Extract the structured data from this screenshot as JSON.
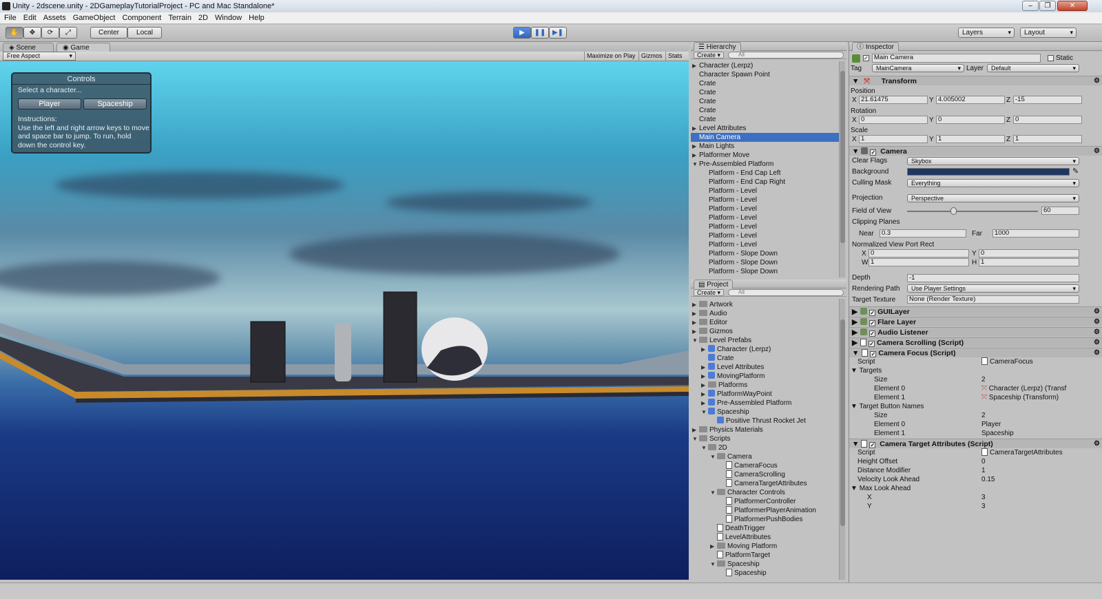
{
  "window": {
    "title": "Unity - 2dscene.unity - 2DGameplayTutorialProject - PC and Mac Standalone*"
  },
  "menu": [
    "File",
    "Edit",
    "Assets",
    "GameObject",
    "Component",
    "Terrain",
    "2D",
    "Window",
    "Help"
  ],
  "toolbar": {
    "pivot": "Center",
    "space": "Local",
    "layers": "Layers",
    "layout": "Layout"
  },
  "scene_tabs": {
    "scene": "Scene",
    "game": "Game",
    "aspect": "Free Aspect",
    "maximize": "Maximize on Play",
    "gizmos": "Gizmos",
    "stats": "Stats"
  },
  "game_ui": {
    "title": "Controls",
    "select": "Select a character...",
    "player": "Player",
    "spaceship": "Spaceship",
    "instructions_title": "Instructions:",
    "instructions": "Use the left and right arrow keys to move and space bar to jump.  To run, hold down the control key."
  },
  "hierarchy": {
    "title": "Hierarchy",
    "create": "Create",
    "search": "All",
    "items": [
      {
        "label": "Character (Lerpz)",
        "arrow": "▶",
        "indent": 0
      },
      {
        "label": "Character Spawn Point",
        "arrow": "",
        "indent": 0
      },
      {
        "label": "Crate",
        "arrow": "",
        "indent": 0
      },
      {
        "label": "Crate",
        "arrow": "",
        "indent": 0
      },
      {
        "label": "Crate",
        "arrow": "",
        "indent": 0
      },
      {
        "label": "Crate",
        "arrow": "",
        "indent": 0
      },
      {
        "label": "Crate",
        "arrow": "",
        "indent": 0
      },
      {
        "label": "Level Attributes",
        "arrow": "▶",
        "indent": 0
      },
      {
        "label": "Main Camera",
        "arrow": "",
        "indent": 0,
        "selected": true
      },
      {
        "label": "Main Lights",
        "arrow": "▶",
        "indent": 0
      },
      {
        "label": "Platformer Move",
        "arrow": "▶",
        "indent": 0
      },
      {
        "label": "Pre-Assembled Platform",
        "arrow": "▼",
        "indent": 0
      },
      {
        "label": "Platform - End Cap Left",
        "arrow": "",
        "indent": 1
      },
      {
        "label": "Platform - End Cap Right",
        "arrow": "",
        "indent": 1
      },
      {
        "label": "Platform - Level",
        "arrow": "",
        "indent": 1
      },
      {
        "label": "Platform - Level",
        "arrow": "",
        "indent": 1
      },
      {
        "label": "Platform - Level",
        "arrow": "",
        "indent": 1
      },
      {
        "label": "Platform - Level",
        "arrow": "",
        "indent": 1
      },
      {
        "label": "Platform - Level",
        "arrow": "",
        "indent": 1
      },
      {
        "label": "Platform - Level",
        "arrow": "",
        "indent": 1
      },
      {
        "label": "Platform - Level",
        "arrow": "",
        "indent": 1
      },
      {
        "label": "Platform - Slope Down",
        "arrow": "",
        "indent": 1
      },
      {
        "label": "Platform - Slope Down",
        "arrow": "",
        "indent": 1
      },
      {
        "label": "Platform - Slope Down",
        "arrow": "",
        "indent": 1
      }
    ]
  },
  "project": {
    "title": "Project",
    "create": "Create",
    "search": "All",
    "items": [
      {
        "label": "Artwork",
        "arrow": "▶",
        "indent": 0,
        "kind": "folder"
      },
      {
        "label": "Audio",
        "arrow": "▶",
        "indent": 0,
        "kind": "folder"
      },
      {
        "label": "Editor",
        "arrow": "▶",
        "indent": 0,
        "kind": "folder"
      },
      {
        "label": "Gizmos",
        "arrow": "▶",
        "indent": 0,
        "kind": "folder"
      },
      {
        "label": "Level Prefabs",
        "arrow": "▼",
        "indent": 0,
        "kind": "folder"
      },
      {
        "label": "Character (Lerpz)",
        "arrow": "▶",
        "indent": 1,
        "kind": "prefab"
      },
      {
        "label": "Crate",
        "arrow": "",
        "indent": 1,
        "kind": "prefab"
      },
      {
        "label": "Level Attributes",
        "arrow": "▶",
        "indent": 1,
        "kind": "prefab"
      },
      {
        "label": "MovingPlatform",
        "arrow": "▶",
        "indent": 1,
        "kind": "prefab"
      },
      {
        "label": "Platforms",
        "arrow": "▶",
        "indent": 1,
        "kind": "folder"
      },
      {
        "label": "PlatformWayPoint",
        "arrow": "▶",
        "indent": 1,
        "kind": "prefab"
      },
      {
        "label": "Pre-Assembled Platform",
        "arrow": "▶",
        "indent": 1,
        "kind": "prefab"
      },
      {
        "label": "Spaceship",
        "arrow": "▼",
        "indent": 1,
        "kind": "prefab"
      },
      {
        "label": "Positive Thrust Rocket Jet",
        "arrow": "",
        "indent": 2,
        "kind": "prefab"
      },
      {
        "label": "Physics Materials",
        "arrow": "▶",
        "indent": 0,
        "kind": "folder"
      },
      {
        "label": "Scripts",
        "arrow": "▼",
        "indent": 0,
        "kind": "folder"
      },
      {
        "label": "2D",
        "arrow": "▼",
        "indent": 1,
        "kind": "folder"
      },
      {
        "label": "Camera",
        "arrow": "▼",
        "indent": 2,
        "kind": "folder"
      },
      {
        "label": "CameraFocus",
        "arrow": "",
        "indent": 3,
        "kind": "script"
      },
      {
        "label": "CameraScrolling",
        "arrow": "",
        "indent": 3,
        "kind": "script"
      },
      {
        "label": "CameraTargetAttributes",
        "arrow": "",
        "indent": 3,
        "kind": "script"
      },
      {
        "label": "Character Controls",
        "arrow": "▼",
        "indent": 2,
        "kind": "folder"
      },
      {
        "label": "PlatformerController",
        "arrow": "",
        "indent": 3,
        "kind": "script"
      },
      {
        "label": "PlatformerPlayerAnimation",
        "arrow": "",
        "indent": 3,
        "kind": "script"
      },
      {
        "label": "PlatformerPushBodies",
        "arrow": "",
        "indent": 3,
        "kind": "script"
      },
      {
        "label": "DeathTrigger",
        "arrow": "",
        "indent": 2,
        "kind": "script"
      },
      {
        "label": "LevelAttributes",
        "arrow": "",
        "indent": 2,
        "kind": "script"
      },
      {
        "label": "Moving Platform",
        "arrow": "▶",
        "indent": 2,
        "kind": "folder"
      },
      {
        "label": "PlatformTarget",
        "arrow": "",
        "indent": 2,
        "kind": "script"
      },
      {
        "label": "Spaceship",
        "arrow": "▼",
        "indent": 2,
        "kind": "folder"
      },
      {
        "label": "Spaceship",
        "arrow": "",
        "indent": 3,
        "kind": "script"
      }
    ]
  },
  "inspector": {
    "title": "Inspector",
    "object_name": "Main Camera",
    "static": "Static",
    "tag_label": "Tag",
    "tag": "MainCamera",
    "layer_label": "Layer",
    "layer": "Default",
    "transform": {
      "title": "Transform",
      "position": "Position",
      "pos": [
        "21.61475",
        "4.005002",
        "-15"
      ],
      "rotation": "Rotation",
      "rot": [
        "0",
        "0",
        "0"
      ],
      "scale": "Scale",
      "scl": [
        "1",
        "1",
        "1"
      ]
    },
    "camera": {
      "title": "Camera",
      "clear_flags_label": "Clear Flags",
      "clear_flags": "Skybox",
      "background_label": "Background",
      "background_color": "#1f3763",
      "culling_label": "Culling Mask",
      "culling": "Everything",
      "projection_label": "Projection",
      "projection": "Perspective",
      "fov_label": "Field of View",
      "fov": "60",
      "fov_fraction": 0.35,
      "clipping_label": "Clipping Planes",
      "near_label": "Near",
      "near": "0.3",
      "far_label": "Far",
      "far": "1000",
      "viewport_label": "Normalized View Port Rect",
      "vx": "0",
      "vy": "0",
      "vw": "1",
      "vh": "1",
      "depth_label": "Depth",
      "depth": "-1",
      "render_path_label": "Rendering Path",
      "render_path": "Use Player Settings",
      "target_label": "Target Texture",
      "target": "None (Render Texture)"
    },
    "components": [
      "GUILayer",
      "Flare Layer",
      "Audio Listener",
      "Camera Scrolling (Script)",
      "Camera Focus (Script)"
    ],
    "camera_focus": {
      "script_label": "Script",
      "script": "CameraFocus",
      "targets_label": "Targets",
      "size_label": "Size",
      "size": "2",
      "el0_label": "Element 0",
      "el0": "Character (Lerpz) (Transf",
      "el1_label": "Element 1",
      "el1": "Spaceship (Transform)",
      "names_label": "Target Button Names",
      "nsize": "2",
      "n0": "Player",
      "n1": "Spaceship"
    },
    "cta": {
      "title": "Camera Target Attributes (Script)",
      "script_label": "Script",
      "script": "CameraTargetAttributes",
      "height_label": "Height Offset",
      "height": "0",
      "distance_label": "Distance Modifier",
      "distance": "1",
      "velocity_label": "Velocity Look Ahead",
      "velocity": "0.15",
      "max_label": "Max Look Ahead",
      "x_label": "X",
      "x": "3",
      "y_label": "Y",
      "y": "3"
    }
  },
  "axes": {
    "x": "X",
    "y": "Y",
    "z": "Z",
    "w": "W",
    "h": "H"
  }
}
